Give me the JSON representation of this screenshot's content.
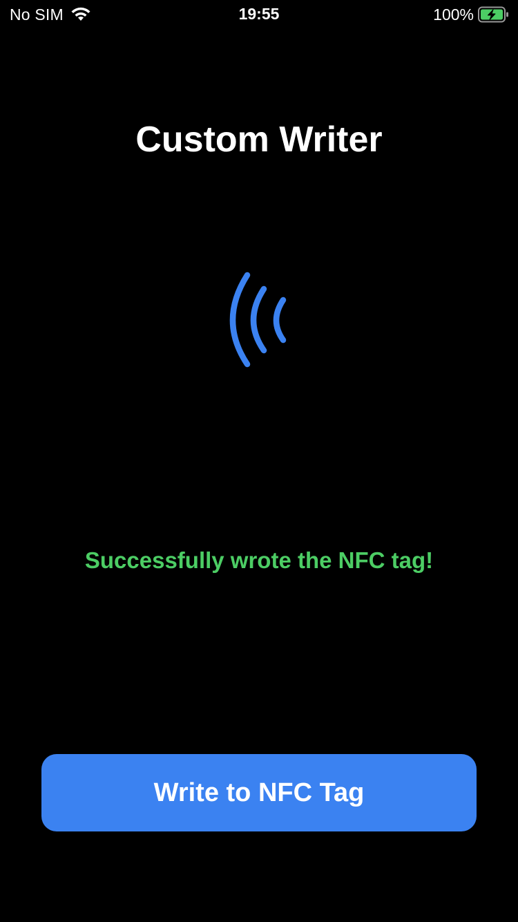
{
  "status_bar": {
    "carrier": "No SIM",
    "time": "19:55",
    "battery_percent": "100%",
    "battery_level": 1.0,
    "charging": true,
    "wifi_icon": "wifi-icon",
    "battery_icon": "battery-charging-icon"
  },
  "header": {
    "title": "Custom Writer"
  },
  "nfc": {
    "icon": "nfc-waves-icon",
    "color": "#3b82f1"
  },
  "status": {
    "message": "Successfully wrote the NFC tag!",
    "color": "#4ccd64"
  },
  "actions": {
    "write_label": "Write to NFC Tag",
    "button_color": "#3b82f1"
  }
}
